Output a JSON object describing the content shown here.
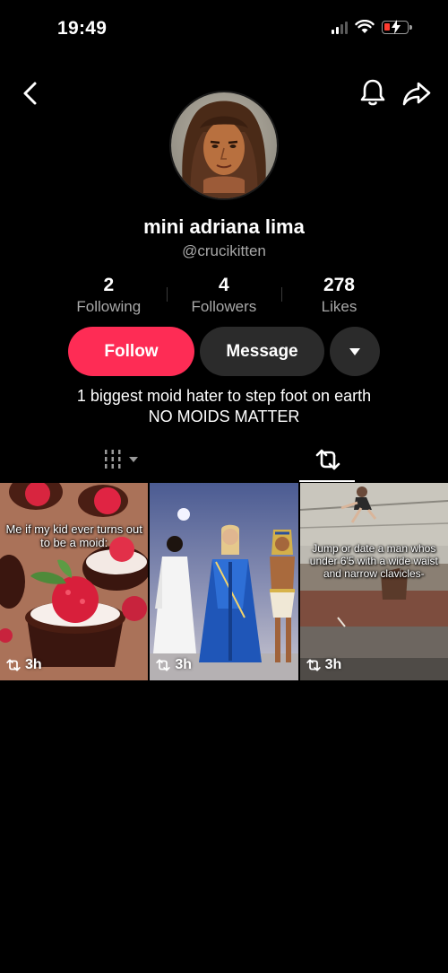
{
  "status_bar": {
    "time": "19:49"
  },
  "profile": {
    "display_name": "mini adriana lima",
    "username": "@crucikitten",
    "bio_line1": "1 biggest moid hater to step foot on earth",
    "bio_line2": "NO MOIDS MATTER"
  },
  "stats": [
    {
      "value": "2",
      "label": "Following"
    },
    {
      "value": "4",
      "label": "Followers"
    },
    {
      "value": "278",
      "label": "Likes"
    }
  ],
  "actions": {
    "follow_label": "Follow",
    "message_label": "Message"
  },
  "videos": [
    {
      "caption": "Me if my kid ever turns out to be a moid:",
      "time": "3h"
    },
    {
      "caption": "",
      "time": "3h"
    },
    {
      "caption": "Jump or date a man whos under 6'5 with a wide waist and narrow clavicles-",
      "time": "3h"
    }
  ],
  "colors": {
    "accent": "#fe2c55",
    "secondary_button": "#2b2b2b",
    "muted_text": "#a8a8a8",
    "background": "#000000"
  }
}
